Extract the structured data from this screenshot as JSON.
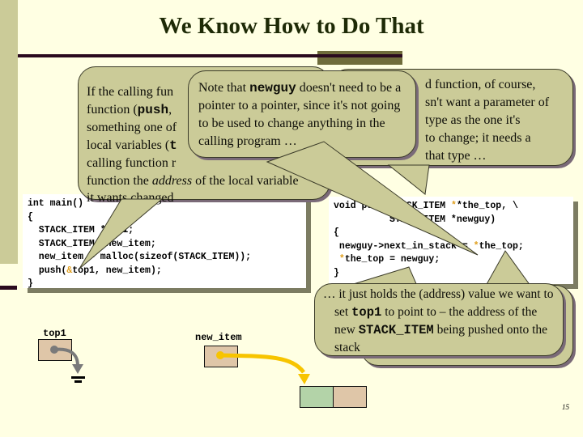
{
  "slide": {
    "title": "We Know How to Do That",
    "page_number": "15"
  },
  "code_main": {
    "lines": [
      "int main()",
      "{",
      "  STACK_ITEM *top1;",
      "  STACK_ITEM *new_item;",
      "  new_item = malloc(sizeof(STACK_ITEM));",
      "  push(&top1, new_item);",
      "}"
    ],
    "highlight_char": "&"
  },
  "code_push": {
    "lines": [
      "void push(STACK_ITEM **the_top, \\",
      "          STACK_ITEM *newguy)",
      "{",
      " newguy->next_in_stack = *the_top;",
      " *the_top = newguy;",
      "}"
    ],
    "highlight_char": "*"
  },
  "callouts": {
    "calling_function": {
      "lines": [
        "If the calling function wants the called",
        "function (push, here) to change",
        "something one of the calling function's",
        "local variables (top1, here), the",
        "calling function must pass the called",
        "function the address of the local variable",
        "it wants changed"
      ],
      "visible_fragments": [
        "If the calling fun",
        "function (",
        "push",
        ",",
        "something one of",
        "local variables (",
        "t",
        "calling function r",
        "function the ",
        "address",
        " of the local variable",
        "it wants changed"
      ]
    },
    "newguy_note": {
      "prefix": "Note that ",
      "code": "newguy",
      "suffix": " doesn't need to be a pointer to a pointer, since it's not going to be used to change anything in the calling program …"
    },
    "called_function": {
      "visible_lines": [
        "d function, of course,",
        "sn't want a parameter of",
        "type as the one it's",
        "to change; it needs a",
        "that type …"
      ]
    },
    "just_holds": {
      "prefix": "… it just holds the (address) value we want to set ",
      "code1": "top1",
      "middle": " to point to – the address of the new ",
      "code2": "STACK_ITEM",
      "suffix": " being pushed onto the stack"
    },
    "behind_fragment": "to change"
  },
  "diagram": {
    "top1_label": "top1",
    "new_item_label": "new_item",
    "colors": {
      "var_box": "#dfc6a8",
      "node_data": "#b3d3a8",
      "node_next": "#dfc6a8",
      "null_arrow": "#7a7a7a",
      "pointer_arrow": "#f7c400"
    }
  }
}
